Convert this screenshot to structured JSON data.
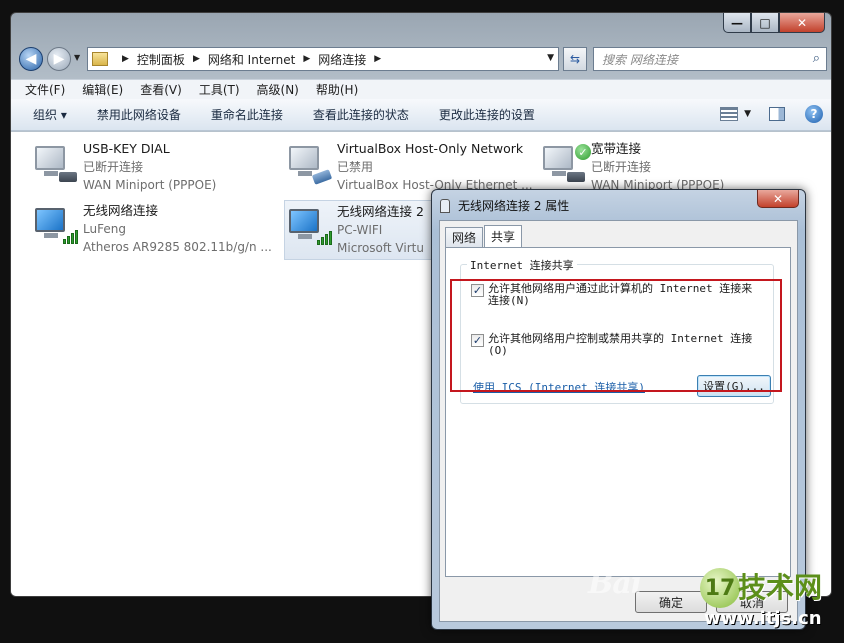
{
  "window": {
    "caption_min": "—",
    "caption_max": "□",
    "caption_close": "✕"
  },
  "address": {
    "crumbs": [
      "控制面板",
      "网络和 Internet",
      "网络连接"
    ],
    "search_placeholder": "搜索 网络连接"
  },
  "menu": [
    "文件(F)",
    "编辑(E)",
    "查看(V)",
    "工具(T)",
    "高级(N)",
    "帮助(H)"
  ],
  "toolbar": {
    "organize": "组织 ▾",
    "items": [
      "禁用此网络设备",
      "重命名此连接",
      "查看此连接的状态",
      "更改此连接的设置"
    ]
  },
  "connections": [
    {
      "name": "USB-KEY DIAL",
      "status": "已断开连接",
      "device": "WAN Miniport (PPPOE)",
      "icon": "wired-computer-icon"
    },
    {
      "name": "VirtualBox Host-Only Network",
      "status": "已禁用",
      "device": "VirtualBox Host-Only Ethernet ...",
      "icon": "network-adapter-icon"
    },
    {
      "name": "宽带连接",
      "status": "已断开连接",
      "device": "WAN Miniport (PPPOE)",
      "icon": "broadband-icon"
    },
    {
      "name": "无线网络连接",
      "status": "LuFeng",
      "device": "Atheros AR9285 802.11b/g/n ...",
      "icon": "wireless-icon"
    },
    {
      "name": "无线网络连接 2",
      "status": "PC-WIFI",
      "device": "Microsoft Virtu",
      "icon": "wireless-icon"
    }
  ],
  "dialog": {
    "title": "无线网络连接 2 属性",
    "close": "✕",
    "tabs": [
      "网络",
      "共享"
    ],
    "active_tab": "共享",
    "group_title": "Internet 连接共享",
    "option1": {
      "checked": true,
      "label": "允许其他网络用户通过此计算机的 Internet 连接来连接(N)"
    },
    "option2": {
      "checked": true,
      "label": "允许其他网络用户控制或禁用共享的 Internet 连接(O)"
    },
    "ics_link": "使用 ICS (Internet 连接共享)",
    "settings_button": "设置(G)...",
    "ok_button": "确定",
    "cancel_button": "取消"
  },
  "watermark": {
    "baidu": "Bai",
    "logo": "17",
    "brand": "技术网",
    "url": "www.itjs.cn"
  },
  "colors": {
    "highlight_box": "#c4171e",
    "link": "#1a5ea8",
    "check_mark": "#1b3a6b"
  }
}
